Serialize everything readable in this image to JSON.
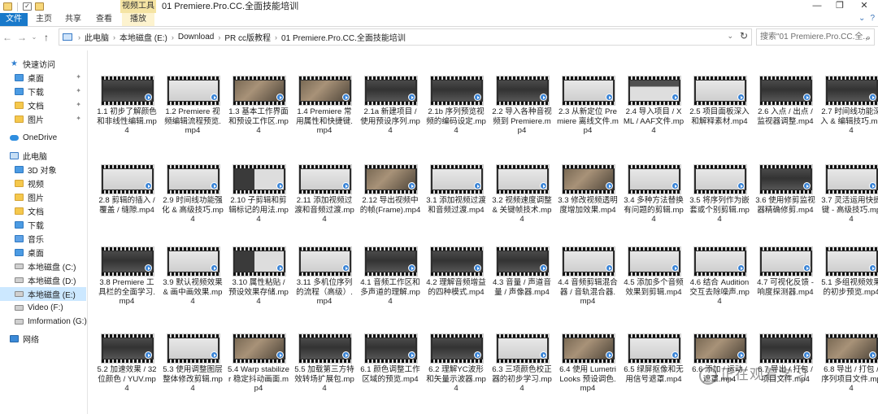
{
  "titlebar": {
    "context_tab": "视频工具",
    "title": "01 Premiere.Pro.CC.全面技能培训",
    "controls": [
      "—",
      "❐",
      "✕"
    ]
  },
  "ribbon": {
    "tabs": [
      "文件",
      "主页",
      "共享",
      "查看",
      "播放"
    ],
    "help": "?"
  },
  "address": {
    "crumbs": [
      "此电脑",
      "本地磁盘 (E:)",
      "Download",
      "PR cc版教程",
      "01 Premiere.Pro.CC.全面技能培训"
    ],
    "search_placeholder": "搜索\"01 Premiere.Pro.CC.全..."
  },
  "navpane": {
    "items": [
      {
        "label": "快速访问",
        "icon": "star-icon"
      },
      {
        "label": "桌面",
        "icon": "desktop-folder-icon",
        "pinned": true
      },
      {
        "label": "下载",
        "icon": "download-folder-icon",
        "pinned": true
      },
      {
        "label": "文档",
        "icon": "documents-folder-icon",
        "pinned": true
      },
      {
        "label": "图片",
        "icon": "pictures-folder-icon",
        "pinned": true
      },
      {
        "label": "OneDrive",
        "icon": "onedrive-cloud-icon"
      },
      {
        "label": "此电脑",
        "icon": "this-pc-icon"
      },
      {
        "label": "3D 对象",
        "icon": "3d-objects-folder-icon"
      },
      {
        "label": "视频",
        "icon": "videos-folder-icon"
      },
      {
        "label": "图片",
        "icon": "pictures-folder-icon"
      },
      {
        "label": "文档",
        "icon": "documents-folder-icon"
      },
      {
        "label": "下载",
        "icon": "download-folder-icon"
      },
      {
        "label": "音乐",
        "icon": "music-folder-icon"
      },
      {
        "label": "桌面",
        "icon": "desktop-folder-icon"
      },
      {
        "label": "本地磁盘 (C:)",
        "icon": "drive-icon"
      },
      {
        "label": "本地磁盘 (D:)",
        "icon": "drive-icon"
      },
      {
        "label": "本地磁盘 (E:)",
        "icon": "drive-icon",
        "selected": true
      },
      {
        "label": "Video (F:)",
        "icon": "drive-icon"
      },
      {
        "label": "Imformation (G:)",
        "icon": "drive-icon"
      },
      {
        "label": "网络",
        "icon": "network-icon"
      }
    ]
  },
  "files": [
    {
      "name": "1.1 初步了解颜色和非线性编辑.mp4",
      "thumb": "dark"
    },
    {
      "name": "1.2 Premiere 视频编辑流程预览.mp4",
      "thumb": "light"
    },
    {
      "name": "1.3 基本工作界面和预设工作区.mp4",
      "thumb": "photo"
    },
    {
      "name": "1.4 Premiere 常用属性和快捷键.mp4",
      "thumb": "photo"
    },
    {
      "name": "2.1a 新建项目 / 使用预设序列.mp4",
      "thumb": "dark"
    },
    {
      "name": "2.1b 序列预览视频的编码设定.mp4",
      "thumb": "dark"
    },
    {
      "name": "2.2 导入各种音视频到 Premiere.mp4",
      "thumb": "dark"
    },
    {
      "name": "2.3 从新定位 Premiere 离线文件.mp4",
      "thumb": "light"
    },
    {
      "name": "2.4 导入项目 / XML / AAF文件.mp4",
      "thumb": "panel"
    },
    {
      "name": "2.5 项目面板深入和解释素材.mp4",
      "thumb": "light"
    },
    {
      "name": "2.6 入点 / 出点 / 监视器调整.mp4",
      "thumb": "dark"
    },
    {
      "name": "2.7 时间线功能深入 & 编辑技巧.mp4",
      "thumb": "dark"
    },
    {
      "name": "2.8 剪辑的插入 / 覆盖 / 缝隙.mp4",
      "thumb": "light"
    },
    {
      "name": "2.9 时间线功能强化 & 高级技巧.mp4",
      "thumb": "light"
    },
    {
      "name": "2.10 子剪辑和剪辑标记的用法.mp4",
      "thumb": "mixed"
    },
    {
      "name": "2.11 添加视频过渡和音频过渡.mp4",
      "thumb": "light"
    },
    {
      "name": "2.12 导出视频中的帧(Frame).mp4",
      "thumb": "photo"
    },
    {
      "name": "3.1 添加视频过渡和音频过渡.mp4",
      "thumb": "light"
    },
    {
      "name": "3.2 视频速度调整 & 关键帧技术.mp4",
      "thumb": "light"
    },
    {
      "name": "3.3 修改视频透明度增加效果.mp4",
      "thumb": "photo"
    },
    {
      "name": "3.4 多种方法替换有问题的剪辑.mp4",
      "thumb": "light"
    },
    {
      "name": "3.5 将序列作为嵌套或个别剪辑.mp4",
      "thumb": "light"
    },
    {
      "name": "3.6 使用修剪监视器精确修剪.mp4",
      "thumb": "dark"
    },
    {
      "name": "3.7 灵活运用快捷键 - 高级技巧.mp4",
      "thumb": "light"
    },
    {
      "name": "3.8 Premiere 工具栏的全面学习.mp4",
      "thumb": "dark"
    },
    {
      "name": "3.9 默认视频效果 & 画中画效果.mp4",
      "thumb": "light"
    },
    {
      "name": "3.10 属性粘贴 / 预设效果存储.mp4",
      "thumb": "mixed"
    },
    {
      "name": "3.11 多机位序列的流程（高级）.mp4",
      "thumb": "light"
    },
    {
      "name": "4.1 音频工作区和多声道的理解.mp4",
      "thumb": "dark"
    },
    {
      "name": "4.2 理解音频增益的四种模式.mp4",
      "thumb": "dark"
    },
    {
      "name": "4.3 音量 / 声道音量 / 声像器.mp4",
      "thumb": "dark"
    },
    {
      "name": "4.4 音频剪辑混合器 / 音轨混合器.mp4",
      "thumb": "light"
    },
    {
      "name": "4.5 添加多个音频效果到剪辑.mp4",
      "thumb": "light"
    },
    {
      "name": "4.6 结合 Audition 交互去除噪声.mp4",
      "thumb": "light"
    },
    {
      "name": "4.7 可视化反馈 - 响度探测器.mp4",
      "thumb": "light"
    },
    {
      "name": "5.1 多组视频效果的初步预览.mp4",
      "thumb": "light"
    },
    {
      "name": "5.2 加速效果 / 32位颜色 / YUV.mp4",
      "thumb": "dark"
    },
    {
      "name": "5.3 使用调整图层整体修改剪辑.mp4",
      "thumb": "light"
    },
    {
      "name": "5.4 Warp stabilizer 稳定抖动画面.mp4",
      "thumb": "photo"
    },
    {
      "name": "5.5 加载第三方特效转场扩展包.mp4",
      "thumb": "dark"
    },
    {
      "name": "6.1 颜色调整工作区域的预览.mp4",
      "thumb": "dark"
    },
    {
      "name": "6.2 理解YC波形和矢量示波器.mp4",
      "thumb": "dark"
    },
    {
      "name": "6.3 三项颜色校正器的初步学习.mp4",
      "thumb": "light"
    },
    {
      "name": "6.4 使用 Lumetri Looks 预设调色.mp4",
      "thumb": "photo"
    },
    {
      "name": "6.5 绿屏抠像和无用信号遮罩.mp4",
      "thumb": "light"
    },
    {
      "name": "6.6 添加 / 运动 / 遮罩.mp4",
      "thumb": "photo"
    },
    {
      "name": "6.7 导出 / 打包 / 项目文件.mp4",
      "thumb": "dark"
    },
    {
      "name": "6.8 导出 / 打包 / 序列项目文件.mp4",
      "thumb": "photo"
    }
  ],
  "watermark": "正在观看学习"
}
